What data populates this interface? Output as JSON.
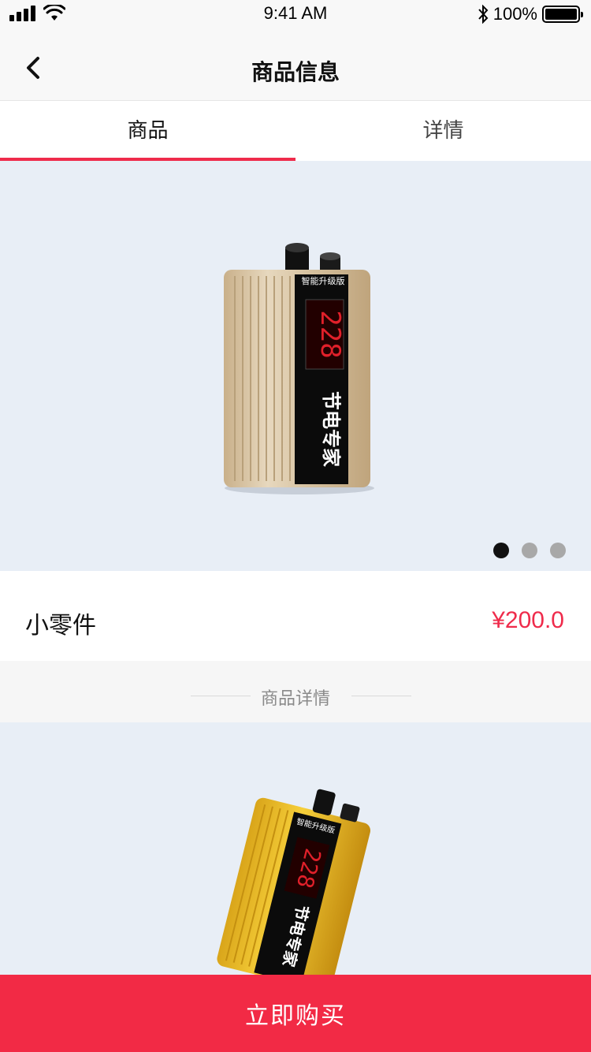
{
  "status_bar": {
    "time": "9:41 AM",
    "battery_percent": "100%",
    "icons": [
      "signal-icon",
      "wifi-icon",
      "bluetooth-icon",
      "battery-icon"
    ]
  },
  "navbar": {
    "title": "商品信息",
    "back_icon": "chevron-left-icon"
  },
  "tabs": [
    {
      "label": "商品",
      "active": true
    },
    {
      "label": "详情",
      "active": false
    }
  ],
  "banner": {
    "device_label_top": "智能升级版",
    "device_display": "228",
    "device_brand": "节电专家",
    "carousel_count": 3,
    "carousel_active_index": 0
  },
  "product": {
    "name": "小零件",
    "price": "¥200.0"
  },
  "detail_section": {
    "title": "商品详情",
    "device_label_top": "智能升级版",
    "device_display": "228",
    "device_brand": "节电专家"
  },
  "action": {
    "buy_label": "立即购买"
  },
  "colors": {
    "accent": "#ef2b4b",
    "buy_button": "#f22a45",
    "banner_bg": "#e8eef6"
  }
}
